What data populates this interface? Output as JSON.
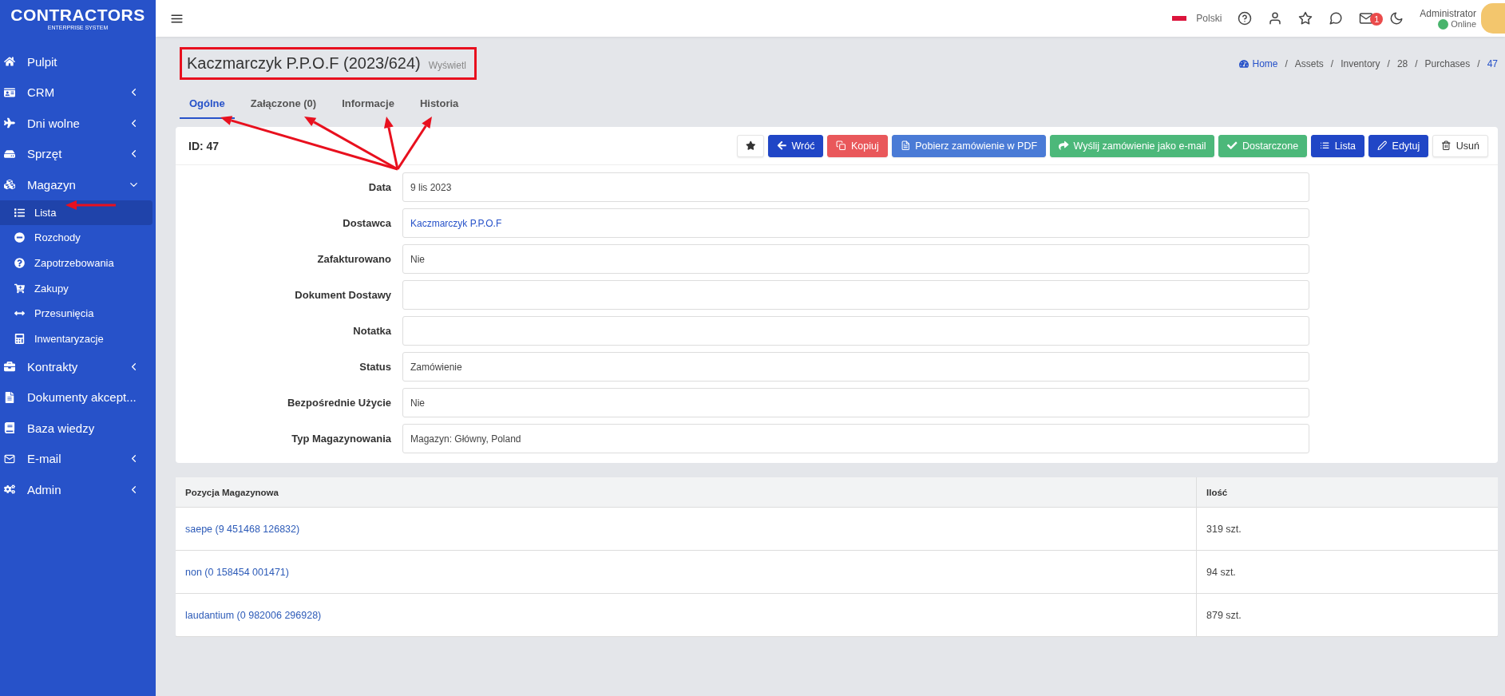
{
  "logo": {
    "name": "CONTRACTORS",
    "subtitle": "ENTERPRISE SYSTEM"
  },
  "sidebar": {
    "items": [
      {
        "label": "Pulpit"
      },
      {
        "label": "CRM",
        "expanded": false
      },
      {
        "label": "Dni wolne",
        "expanded": false
      },
      {
        "label": "Sprzęt",
        "expanded": false
      },
      {
        "label": "Magazyn",
        "expanded": true,
        "children": [
          {
            "label": "Lista",
            "selected": true
          },
          {
            "label": "Rozchody",
            "selected": false
          },
          {
            "label": "Zapotrzebowania",
            "selected": false
          },
          {
            "label": "Zakupy",
            "selected": false
          },
          {
            "label": "Przesunięcia",
            "selected": false
          },
          {
            "label": "Inwentaryzacje",
            "selected": false
          }
        ]
      },
      {
        "label": "Kontrakty",
        "expanded": false
      },
      {
        "label": "Dokumenty akcept..."
      },
      {
        "label": "Baza wiedzy"
      },
      {
        "label": "E-mail",
        "expanded": false
      },
      {
        "label": "Admin",
        "expanded": false
      }
    ]
  },
  "header": {
    "language": "Polski",
    "mail_badge": "1",
    "user": {
      "name": "Administrator",
      "status": "Online"
    }
  },
  "page": {
    "title": "Kaczmarczyk P.P.O.F (2023/624)",
    "subtitle": "Wyświetl"
  },
  "breadcrumb": {
    "separator": "/",
    "items": [
      "Home",
      "Assets",
      "Inventory",
      "28",
      "Purchases",
      "47"
    ]
  },
  "tabs": [
    {
      "label": "Ogólne",
      "selected": true
    },
    {
      "label": "Załączone (0)",
      "selected": false
    },
    {
      "label": "Informacje",
      "selected": false
    },
    {
      "label": "Historia",
      "selected": false
    }
  ],
  "record": {
    "id": "ID: 47"
  },
  "buttons": [
    {
      "kind": "default"
    },
    {
      "kind": "primary",
      "label": "Wróć"
    },
    {
      "kind": "danger",
      "label": "Kopiuj"
    },
    {
      "kind": "info",
      "label": "Pobierz zamówienie w PDF"
    },
    {
      "kind": "success",
      "label": "Wyślij zamówienie jako e-mail"
    },
    {
      "kind": "success",
      "label": "Dostarczone"
    },
    {
      "kind": "primary",
      "label": "Lista"
    },
    {
      "kind": "primary",
      "label": "Edytuj"
    },
    {
      "kind": "default",
      "label": "Usuń"
    }
  ],
  "fields": [
    {
      "label": "Data",
      "value": "9 lis 2023",
      "kind": "text"
    },
    {
      "label": "Dostawca",
      "value": "Kaczmarczyk P.P.O.F",
      "kind": "link"
    },
    {
      "label": "Zafakturowano",
      "value": "Nie",
      "kind": "text"
    },
    {
      "label": "Dokument Dostawy",
      "kind": "text"
    },
    {
      "label": "Notatka",
      "kind": "text"
    },
    {
      "label": "Status",
      "value": "Zamówienie",
      "kind": "text"
    },
    {
      "label": "Bezpośrednie Użycie",
      "value": "Nie",
      "kind": "text"
    },
    {
      "label": "Typ Magazynowania",
      "value": "Magazyn: Główny, Poland",
      "kind": "text"
    }
  ],
  "table": {
    "columns": [
      "Pozycja Magazynowa",
      "Ilość"
    ],
    "rows": [
      {
        "item": "saepe (9 451468 126832)",
        "quantity": "319 szt."
      },
      {
        "item": "non (0 158454 001471)",
        "quantity": "94 szt."
      },
      {
        "item": "laudantium (0 982006 296928)",
        "quantity": "879 szt."
      }
    ]
  }
}
